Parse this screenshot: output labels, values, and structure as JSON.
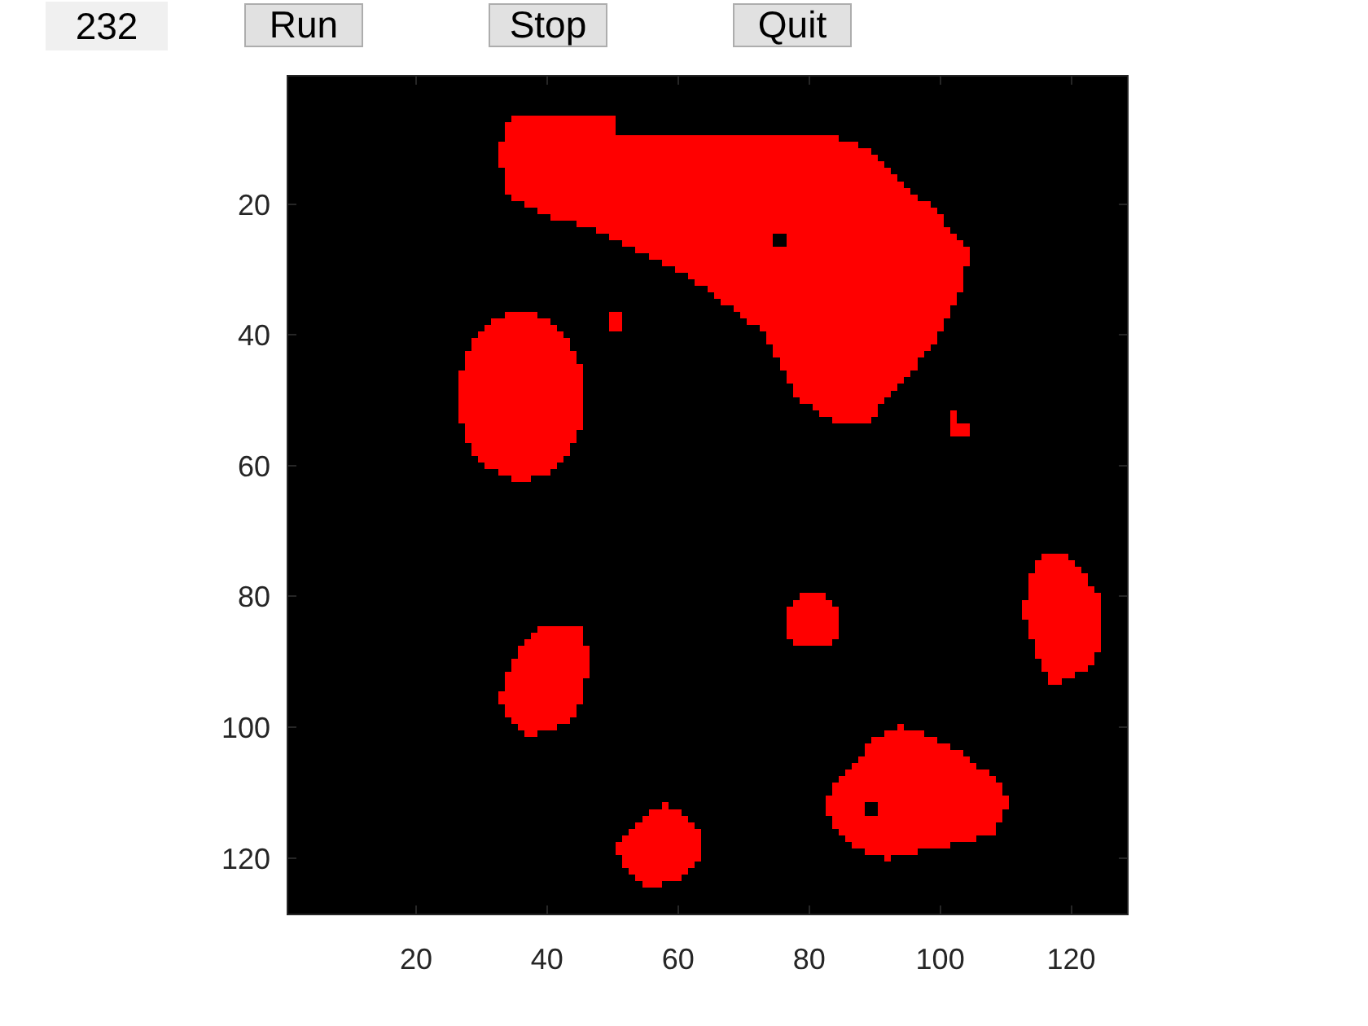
{
  "counter": "232",
  "buttons": [
    {
      "label": "Run"
    },
    {
      "label": "Stop"
    },
    {
      "label": "Quit"
    }
  ],
  "plot": {
    "xticks": [
      "20",
      "40",
      "60",
      "80",
      "100",
      "120"
    ],
    "yticks": [
      "20",
      "40",
      "60",
      "80",
      "100",
      "120"
    ]
  }
}
